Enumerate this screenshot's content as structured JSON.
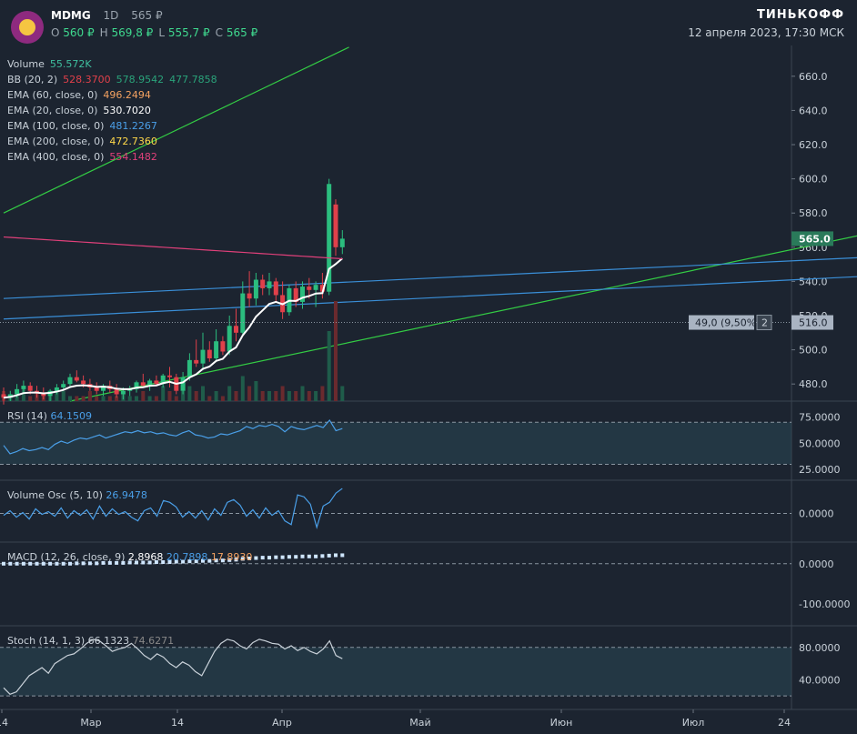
{
  "header": {
    "ticker": "MDMG",
    "interval": "1D",
    "price": "565 ₽",
    "ohlc": [
      {
        "key": "O",
        "value": "560 ₽"
      },
      {
        "key": "H",
        "value": "569,8 ₽"
      },
      {
        "key": "L",
        "value": "555,7 ₽"
      },
      {
        "key": "C",
        "value": "565 ₽"
      }
    ],
    "brand": "ТИНЬКОФФ",
    "datetime": "12 апреля 2023, 17:30 МСК"
  },
  "indicators": [
    {
      "label": "Volume",
      "values": [
        {
          "v": "55.572K",
          "color": "#3fbf9f"
        }
      ]
    },
    {
      "label": "BB (20, 2)",
      "values": [
        {
          "v": "528.3700",
          "color": "#e0404a"
        },
        {
          "v": "578.9542",
          "color": "#2aa37a"
        },
        {
          "v": "477.7858",
          "color": "#2aa37a"
        }
      ]
    },
    {
      "label": "EMA (60, close, 0)",
      "values": [
        {
          "v": "496.2494",
          "color": "#f4a261"
        }
      ]
    },
    {
      "label": "EMA (20, close, 0)",
      "values": [
        {
          "v": "530.7020",
          "color": "#ffffff"
        }
      ]
    },
    {
      "label": "EMA (100, close, 0)",
      "values": [
        {
          "v": "481.2267",
          "color": "#4a9fe8"
        }
      ]
    },
    {
      "label": "EMA (200, close, 0)",
      "values": [
        {
          "v": "472.7360",
          "color": "#ffd84a"
        }
      ]
    },
    {
      "label": "EMA (400, close, 0)",
      "values": [
        {
          "v": "554.1482",
          "color": "#e0407a"
        }
      ]
    }
  ],
  "chart_data": {
    "type": "candlestick",
    "x_ticks": [
      "14",
      "Мар",
      "14",
      "Апр",
      "Май",
      "Июн",
      "Июл",
      "24"
    ],
    "price_axis": {
      "ylim": [
        470,
        678
      ],
      "ticks": [
        480,
        500,
        520,
        540,
        560,
        580,
        600,
        620,
        640,
        660
      ]
    },
    "last_price_label": "565.0",
    "measure_label": "49,0 (9,50%)",
    "measure_count": "2",
    "measure_price": "516.0",
    "candles": [
      [
        474,
        478,
        468,
        472
      ],
      [
        472,
        476,
        470,
        474
      ],
      [
        474,
        480,
        472,
        477
      ],
      [
        477,
        482,
        475,
        479
      ],
      [
        479,
        481,
        474,
        476
      ],
      [
        476,
        479,
        472,
        475
      ],
      [
        475,
        478,
        471,
        473
      ],
      [
        473,
        477,
        470,
        476
      ],
      [
        476,
        480,
        474,
        478
      ],
      [
        478,
        482,
        476,
        480
      ],
      [
        480,
        486,
        478,
        484
      ],
      [
        484,
        488,
        481,
        482
      ],
      [
        482,
        485,
        478,
        480
      ],
      [
        480,
        483,
        476,
        478
      ],
      [
        478,
        481,
        474,
        476
      ],
      [
        476,
        480,
        473,
        479
      ],
      [
        479,
        482,
        475,
        477
      ],
      [
        477,
        480,
        472,
        474
      ],
      [
        474,
        478,
        471,
        476
      ],
      [
        476,
        479,
        473,
        477
      ],
      [
        477,
        482,
        475,
        481
      ],
      [
        481,
        486,
        478,
        479
      ],
      [
        479,
        483,
        476,
        482
      ],
      [
        482,
        485,
        479,
        480
      ],
      [
        480,
        486,
        478,
        485
      ],
      [
        485,
        490,
        478,
        484
      ],
      [
        484,
        486,
        474,
        476
      ],
      [
        476,
        487,
        474,
        484
      ],
      [
        484,
        498,
        482,
        494
      ],
      [
        494,
        506,
        490,
        492
      ],
      [
        492,
        510,
        488,
        500
      ],
      [
        500,
        505,
        493,
        495
      ],
      [
        495,
        512,
        493,
        505
      ],
      [
        505,
        508,
        497,
        499
      ],
      [
        499,
        520,
        497,
        514
      ],
      [
        514,
        524,
        505,
        510
      ],
      [
        510,
        540,
        508,
        533
      ],
      [
        533,
        546,
        525,
        530
      ],
      [
        530,
        545,
        526,
        541
      ],
      [
        541,
        544,
        532,
        536
      ],
      [
        536,
        545,
        532,
        540
      ],
      [
        540,
        542,
        528,
        532
      ],
      [
        532,
        540,
        518,
        522
      ],
      [
        522,
        538,
        520,
        536
      ],
      [
        536,
        540,
        525,
        528
      ],
      [
        528,
        540,
        524,
        537
      ],
      [
        537,
        542,
        530,
        535
      ],
      [
        535,
        540,
        525,
        538
      ],
      [
        538,
        545,
        530,
        534
      ],
      [
        534,
        600,
        532,
        597
      ],
      [
        585,
        588,
        555,
        560
      ],
      [
        560,
        570,
        556,
        565
      ]
    ],
    "volume": [
      2,
      1,
      1,
      3,
      1,
      2,
      1,
      1,
      2,
      2,
      1,
      1,
      1,
      2,
      1,
      1,
      1,
      1,
      2,
      1,
      1,
      2,
      1,
      1,
      3,
      2,
      1,
      2,
      3,
      2,
      3,
      1,
      2,
      1,
      3,
      2,
      5,
      3,
      4,
      2,
      2,
      2,
      3,
      2,
      2,
      3,
      2,
      2,
      3,
      14,
      20,
      3
    ],
    "trendlines": [
      {
        "color": "#33cc44",
        "from": [
          0,
          580
        ],
        "to": [
          52,
          677
        ]
      },
      {
        "color": "#33cc44",
        "from": [
          10,
          470
        ],
        "to": [
          140,
          576
        ]
      },
      {
        "color": "#3a8fd8",
        "from": [
          0,
          530
        ],
        "to": [
          140,
          556
        ]
      },
      {
        "color": "#3a8fd8",
        "from": [
          0,
          518
        ],
        "to": [
          140,
          545
        ]
      }
    ],
    "panels": [
      {
        "name": "RSI (14)",
        "value": "64.1509",
        "value_color": "#4a9fe8",
        "ticks": [
          "75.0000",
          "50.0000",
          "25.0000"
        ],
        "series": [
          48,
          40,
          42,
          45,
          43,
          44,
          46,
          44,
          49,
          52,
          50,
          53,
          55,
          54,
          56,
          58,
          55,
          57,
          59,
          61,
          60,
          62,
          60,
          61,
          59,
          60,
          58,
          57,
          60,
          62,
          58,
          57,
          55,
          56,
          59,
          58,
          60,
          62,
          66,
          64,
          67,
          66,
          68,
          66,
          61,
          66,
          64,
          63,
          65,
          67,
          65,
          72,
          62,
          64
        ]
      },
      {
        "name": "Volume Osc (5, 10)",
        "value": "26.9478",
        "value_color": "#4a9fe8",
        "ticks": [
          "0.0000"
        ],
        "series": [
          -2,
          3,
          -4,
          1,
          -6,
          5,
          -1,
          2,
          -3,
          6,
          -5,
          3,
          -2,
          4,
          -6,
          8,
          -3,
          5,
          -1,
          2,
          -4,
          -8,
          3,
          6,
          -3,
          14,
          12,
          7,
          -4,
          2,
          -5,
          3,
          -7,
          5,
          -2,
          12,
          15,
          9,
          -3,
          4,
          -5,
          6,
          -2,
          3,
          -8,
          -12,
          20,
          18,
          10,
          -15,
          8,
          12,
          22,
          27
        ]
      },
      {
        "name": "MACD (12, 26, close, 9)",
        "value": "2.8968",
        "value_color": "#ffffff",
        "extra": [
          {
            "v": "20.7898",
            "color": "#4a9fe8"
          },
          {
            "v": "17.8930",
            "color": "#f4a261"
          }
        ],
        "ticks": [
          "0.0000",
          "-100.0000"
        ],
        "series": [
          -3,
          -3,
          -2,
          -2,
          -2,
          -1,
          -1,
          -1,
          0,
          0,
          0,
          1,
          1,
          1,
          1,
          2,
          2,
          2,
          2,
          3,
          3,
          3,
          3,
          4,
          4,
          4,
          5,
          5,
          6,
          6,
          7,
          7,
          8,
          8,
          9,
          10,
          12,
          13,
          14,
          15,
          15,
          16,
          16,
          17,
          17,
          18,
          18,
          18,
          19,
          20,
          21,
          21
        ]
      },
      {
        "name": "Stoch (14, 1, 3)",
        "value": "66.1323",
        "value_color": "#c9d1d9",
        "extra": [
          {
            "v": "74.6271",
            "color": "#888888"
          }
        ],
        "ticks": [
          "80.0000",
          "40.0000"
        ],
        "series": [
          30,
          22,
          25,
          35,
          45,
          50,
          55,
          48,
          60,
          65,
          70,
          72,
          78,
          85,
          90,
          88,
          82,
          75,
          78,
          80,
          85,
          78,
          70,
          65,
          72,
          68,
          60,
          55,
          62,
          58,
          50,
          45,
          60,
          75,
          85,
          90,
          88,
          82,
          78,
          86,
          90,
          88,
          85,
          84,
          78,
          82,
          76,
          80,
          75,
          72,
          78,
          88,
          70,
          66
        ]
      }
    ]
  }
}
